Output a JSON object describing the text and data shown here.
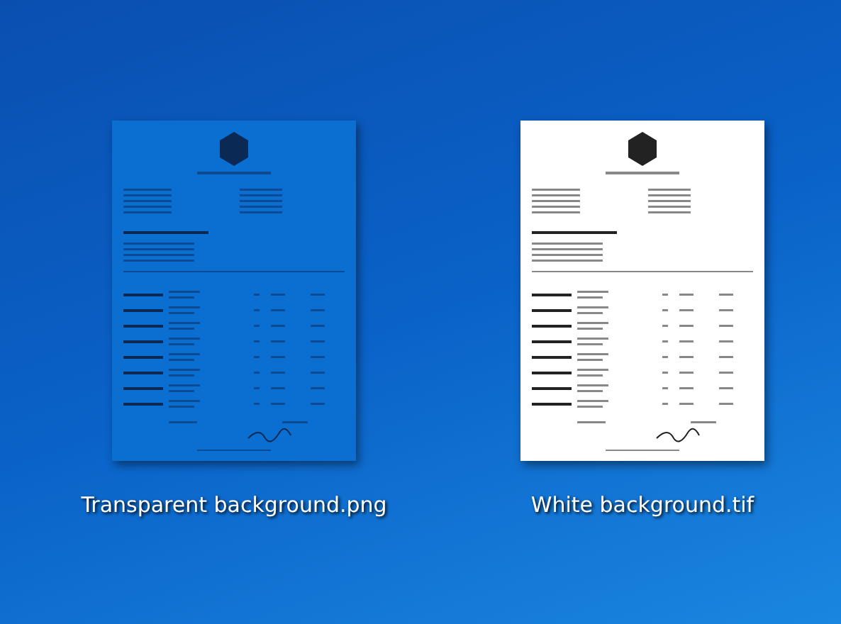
{
  "desktop_icons": [
    {
      "label": "Transparent background.png",
      "kind": "transparent"
    },
    {
      "label": "White background.tif",
      "kind": "white"
    }
  ]
}
